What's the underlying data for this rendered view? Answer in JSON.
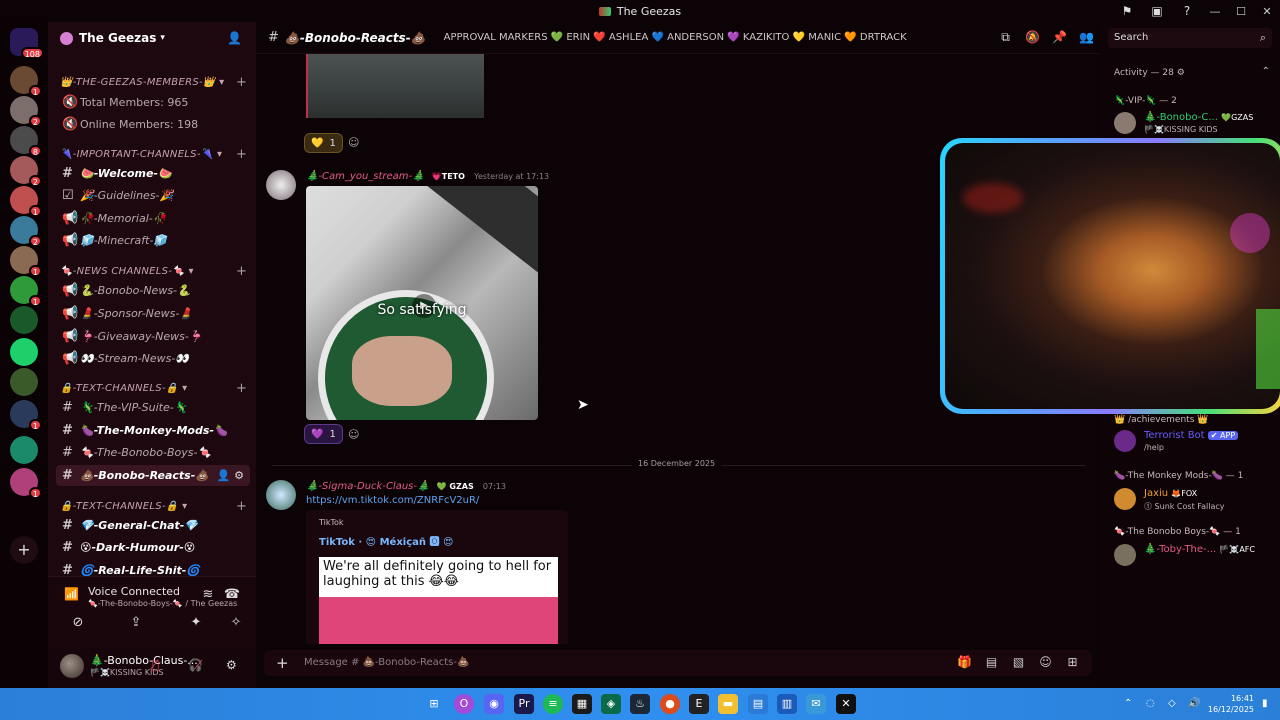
{
  "window": {
    "title": "The Geezas",
    "tray_icons": [
      "inbox-icon",
      "screen-icon",
      "help-icon"
    ]
  },
  "guilds": {
    "home_badge": "108",
    "items": [
      {
        "name": "server-1",
        "badge": "1",
        "color": "#6a4a32"
      },
      {
        "name": "server-2",
        "badge": "2",
        "color": "#7c6e6a"
      },
      {
        "name": "server-3",
        "badge": "8",
        "color": "#4b4b4b"
      },
      {
        "name": "server-4",
        "badge": "2",
        "color": "#a45a5a"
      },
      {
        "name": "server-5",
        "badge": "1",
        "color": "#c05050"
      },
      {
        "name": "server-6",
        "badge": "2",
        "color": "#3a7a9a"
      },
      {
        "name": "server-7",
        "badge": "1",
        "color": "#8a6a52"
      },
      {
        "name": "server-8",
        "badge": "1",
        "color": "#2e9a3a"
      },
      {
        "name": "server-9",
        "badge": "",
        "color": "#1a5a2a"
      },
      {
        "name": "server-10",
        "badge": "",
        "color": "#1ed06a"
      },
      {
        "name": "server-11",
        "badge": "",
        "color": "#3a5a2a"
      },
      {
        "name": "server-12",
        "badge": "1",
        "color": "#2a3a5a"
      },
      {
        "name": "server-13",
        "badge": "",
        "color": "#1b8a6a"
      },
      {
        "name": "server-14",
        "badge": "1",
        "color": "#b0407a"
      }
    ]
  },
  "server": {
    "name": "The Geezas",
    "categories": [
      {
        "label": "👑-THE-GEEZAS-MEMBERS-👑"
      },
      {
        "label": "🌂-IMPORTANT-CHANNELS-🌂"
      },
      {
        "label": "🍬-NEWS CHANNELS-🍬"
      },
      {
        "label": "🔒-TEXT-CHANNELS-🔒"
      },
      {
        "label": "🔒-TEXT-CHANNELS-🔒"
      }
    ],
    "channels": [
      {
        "label": "Total Members: 965",
        "icon": "🔇"
      },
      {
        "label": "Online Members: 198",
        "icon": "🔇"
      },
      {
        "label": "🍉-Welcome-🍉",
        "icon": "#"
      },
      {
        "label": "🎉-Guidelines-🎉",
        "icon": "☑"
      },
      {
        "label": "🥀-Memorial-🥀",
        "icon": "📢"
      },
      {
        "label": "🧊-Minecraft-🧊",
        "icon": "📢"
      },
      {
        "label": "🐍-Bonobo-News-🐍",
        "icon": "📢"
      },
      {
        "label": "💄-Sponsor-News-💄",
        "icon": "📢"
      },
      {
        "label": "🦩-Giveaway-News-🦩",
        "icon": "📢"
      },
      {
        "label": "👀-Stream-News-👀",
        "icon": "📢"
      },
      {
        "label": "🦎-The-VIP-Suite-🦎",
        "icon": "#"
      },
      {
        "label": "🍆-The-Monkey-Mods-🍆",
        "icon": "#"
      },
      {
        "label": "🍬-The-Bonobo-Boys-🍬",
        "icon": "#"
      },
      {
        "label": "💩-Bonobo-Reacts-💩",
        "icon": "#"
      },
      {
        "label": "💎-General-Chat-💎",
        "icon": "#"
      },
      {
        "label": "😵-Dark-Humour-😵",
        "icon": "#"
      },
      {
        "label": "🌀-Real-Life-Shit-🌀",
        "icon": "#"
      }
    ]
  },
  "voice": {
    "title": "Voice Connected",
    "channel": "🍬-The-Bonobo-Boys-🍬 / The Geezas"
  },
  "user": {
    "name": "🎄-Bonobo-Claus-...",
    "status": "🏴☠️KISSING KIDS"
  },
  "chat": {
    "channel_name": "💩-Bonobo-Reacts-💩",
    "topic": "APPROVAL MARKERS 💚 ERIN ❤️ ASHLEA 💙 ANDERSON 💜 KAZIKITO 💛 MANIC 🧡 DRTRACK",
    "messages": [
      {
        "author": "🎄-Cam_you_stream-🎄",
        "author_color": "#e35a8a",
        "role": "💗TETO",
        "time": "Yesterday at 17:13",
        "media_caption": "So satisfying",
        "reaction_emoji": "💜",
        "reaction_count": "1"
      },
      {
        "author": "🎄-Sigma-Duck-Claus-🎄",
        "author_color": "#e35a8a",
        "role": "💚 GZAS",
        "time": "07:13",
        "link": "https://vm.tiktok.com/ZNRFcV2uR/",
        "embed_provider": "TikTok",
        "embed_title": "TikTok · 😍 Méxiçañ 🅾 😍",
        "embed_text": "We're all definitely going to hell for laughing at this 😂😂"
      }
    ],
    "earlier_reaction_emoji": "💛",
    "earlier_reaction_count": "1",
    "date_divider": "16 December 2025",
    "input_placeholder": "Message # 💩-Bonobo-Reacts-💩"
  },
  "members": {
    "search_placeholder": "Search",
    "activity_heading": "Activity — 28 ⚙",
    "groups": [
      {
        "heading": "🦎-VIP-🦎 — 2"
      },
      {
        "heading": "🍆-The Monkey Mods-🍆 — 1"
      },
      {
        "heading": "🍬-The Bonobo Boys-🍬 — 1"
      }
    ],
    "people": [
      {
        "name": "🎄-Bonobo-C...",
        "tag": "💚GZAS",
        "sub": "🏴☠️KISSING KIDS",
        "color": "#2ecc71"
      },
      {
        "name": "Terrorist Bot",
        "tag": "✔ APP",
        "sub": "/help",
        "color": "#6b5cff"
      },
      {
        "name": "Jaxiu",
        "tag": "🦊FOX",
        "sub": "⓵ Sunk Cost Fallacy",
        "color": "#f0a030"
      },
      {
        "name": "🎄-Toby-The-...",
        "tag": "🏴☠️AFC",
        "sub": "",
        "color": "#e35a8a"
      }
    ],
    "achievements_label": "👑 /achievements 👑"
  },
  "taskbar": {
    "time": "16:41",
    "date": "16/12/2025"
  },
  "colors": {
    "accent_pink": "#e35a8a",
    "active_channel_bg": "#3a1622",
    "taskbar_blue": "#2f8ff0"
  }
}
